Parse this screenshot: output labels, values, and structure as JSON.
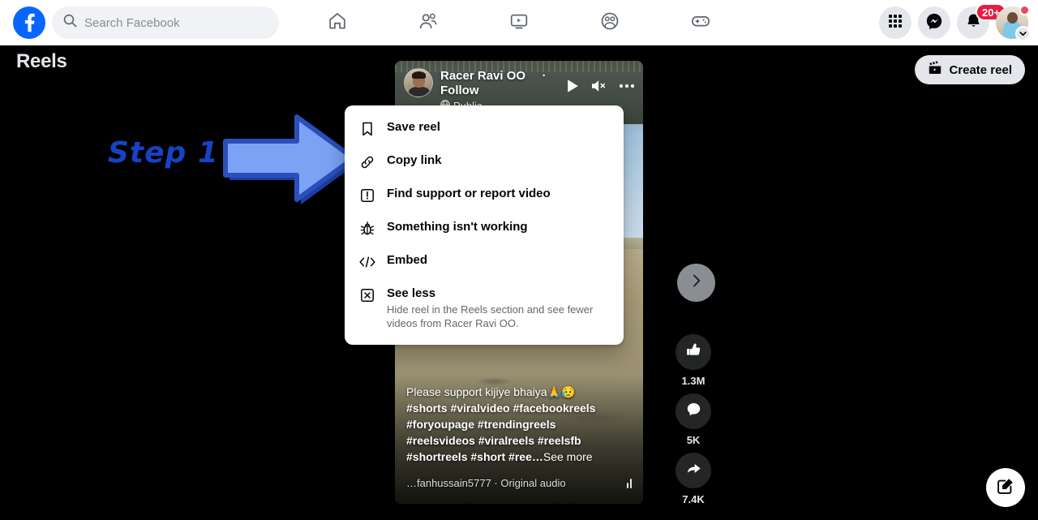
{
  "header": {
    "logo_icon": "facebook-logo-icon",
    "search": {
      "placeholder": "Search Facebook",
      "value": "",
      "icon": "search-icon"
    },
    "nav_tabs": [
      {
        "name": "home",
        "icon": "home-icon"
      },
      {
        "name": "friends",
        "icon": "friends-icon"
      },
      {
        "name": "watch",
        "icon": "video-icon"
      },
      {
        "name": "groups",
        "icon": "groups-icon"
      },
      {
        "name": "gaming",
        "icon": "gaming-icon"
      }
    ],
    "right_actions": [
      {
        "name": "menu-grid",
        "icon": "grid-icon"
      },
      {
        "name": "messenger",
        "icon": "messenger-icon"
      },
      {
        "name": "notifications",
        "icon": "bell-icon",
        "badge": "20+"
      }
    ],
    "account": {
      "name": "account-avatar",
      "badge_dot": true,
      "chevron": "chevron-down-icon"
    }
  },
  "reels_bar": {
    "title": "Reels",
    "create_button": {
      "label": "Create reel",
      "icon": "clapperboard-icon"
    }
  },
  "reel": {
    "author": "Racer Ravi OO",
    "follow_label": "· Follow",
    "privacy": "Public",
    "privacy_icon": "globe-icon",
    "controls": [
      {
        "name": "play",
        "icon": "play-icon"
      },
      {
        "name": "mute",
        "icon": "speaker-muted-icon"
      },
      {
        "name": "options",
        "icon": "ellipsis-icon"
      }
    ],
    "caption": {
      "line1": "Please support kijiye bhaiya🙏😥",
      "line2": "#shorts #viralvideo #facebookreels",
      "line3": "#foryoupage #trendingreels",
      "line4": "#reelsvideos #viralreels #reelsfb",
      "line5": "#shortreels #short #ree…",
      "see_more": "See more"
    },
    "audio": "…fanhussain5777 · Original audio",
    "audio_indicator_icon": "equalizer-icon",
    "next_button_icon": "chevron-right-icon"
  },
  "actions": [
    {
      "name": "like",
      "icon": "thumbs-up-icon",
      "count": "1.3M"
    },
    {
      "name": "comment",
      "icon": "comment-icon",
      "count": "5K"
    },
    {
      "name": "share",
      "icon": "share-icon",
      "count": "7.4K"
    }
  ],
  "menu": {
    "items": [
      {
        "name": "save-reel",
        "icon": "bookmark-icon",
        "label": "Save reel",
        "sub": ""
      },
      {
        "name": "copy-link",
        "icon": "link-icon",
        "label": "Copy link",
        "sub": ""
      },
      {
        "name": "find-support-or-report-video",
        "icon": "report-icon",
        "label": "Find support or report video",
        "sub": ""
      },
      {
        "name": "something-isnt-working",
        "icon": "bug-icon",
        "label": "Something isn't working",
        "sub": ""
      },
      {
        "name": "embed",
        "icon": "code-icon",
        "label": "Embed",
        "sub": ""
      },
      {
        "name": "see-less",
        "icon": "hide-icon",
        "label": "See less",
        "sub": "Hide reel in the Reels section and see fewer videos from Racer Ravi OO."
      }
    ]
  },
  "annotation": {
    "step_label": "Step 1",
    "arrow_icon": "right-arrow-annotation-icon",
    "arrow_color": "#6b96f0",
    "step_color": "#1742c4"
  },
  "fab": {
    "name": "compose",
    "icon": "compose-icon"
  },
  "colors": {
    "brand_blue": "#0866ff",
    "badge_red": "#e41e3f",
    "dark_bg": "#000000",
    "chip_bg": "#e4e6eb"
  }
}
